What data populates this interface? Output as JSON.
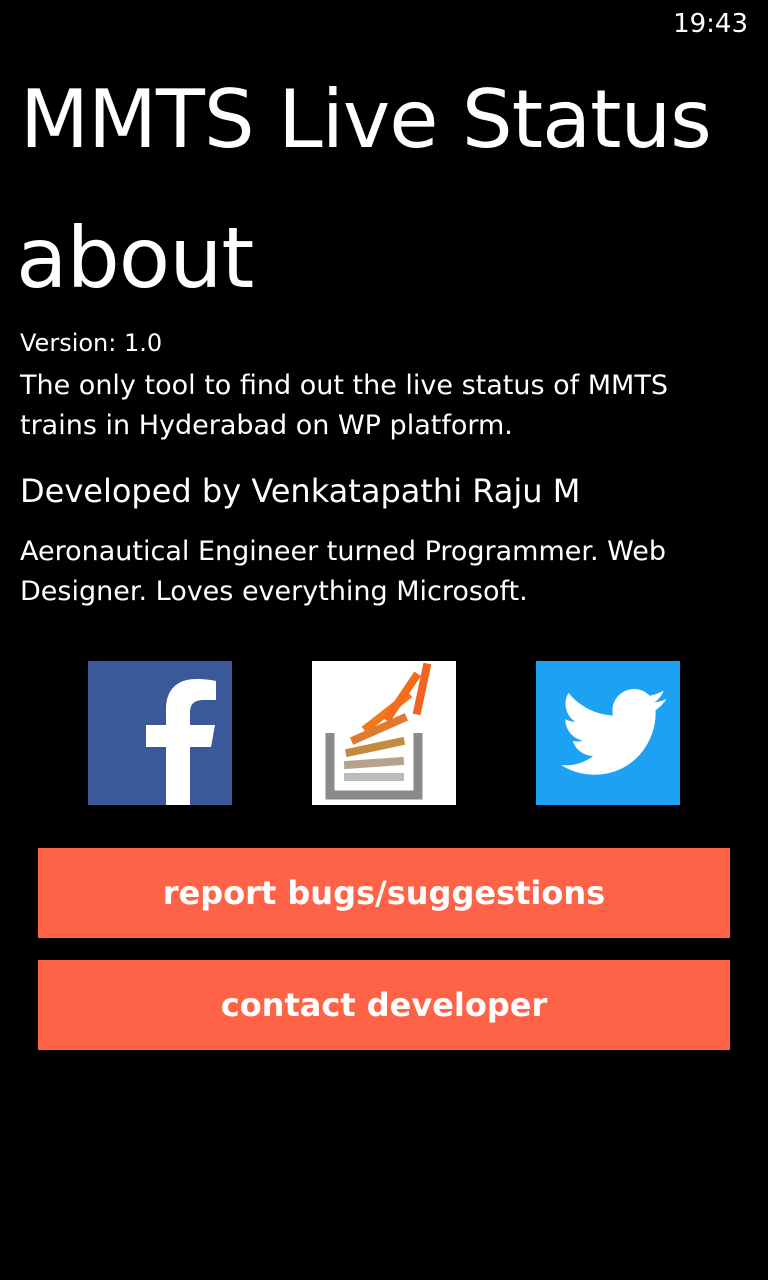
{
  "status_bar": {
    "time": "19:43"
  },
  "app_title": "MMTS Live Status",
  "page_title": "about",
  "version": "Version: 1.0",
  "description": "The only tool to find out the live status of MMTS trains in Hyderabad on WP platform.",
  "developer": "Developed by Venkatapathi Raju M",
  "bio": "Aeronautical Engineer turned Programmer. Web Designer. Loves everything Microsoft.",
  "social": [
    {
      "name": "facebook",
      "icon": "facebook-icon",
      "color": "#3b5998"
    },
    {
      "name": "stackoverflow",
      "icon": "stackoverflow-icon",
      "color": "#ffffff"
    },
    {
      "name": "twitter",
      "icon": "twitter-icon",
      "color": "#1da1f2"
    }
  ],
  "buttons": {
    "report_label": "report bugs/suggestions",
    "contact_label": "contact developer"
  },
  "colors": {
    "background": "#000000",
    "text": "#ffffff",
    "accent": "#ff6347"
  }
}
